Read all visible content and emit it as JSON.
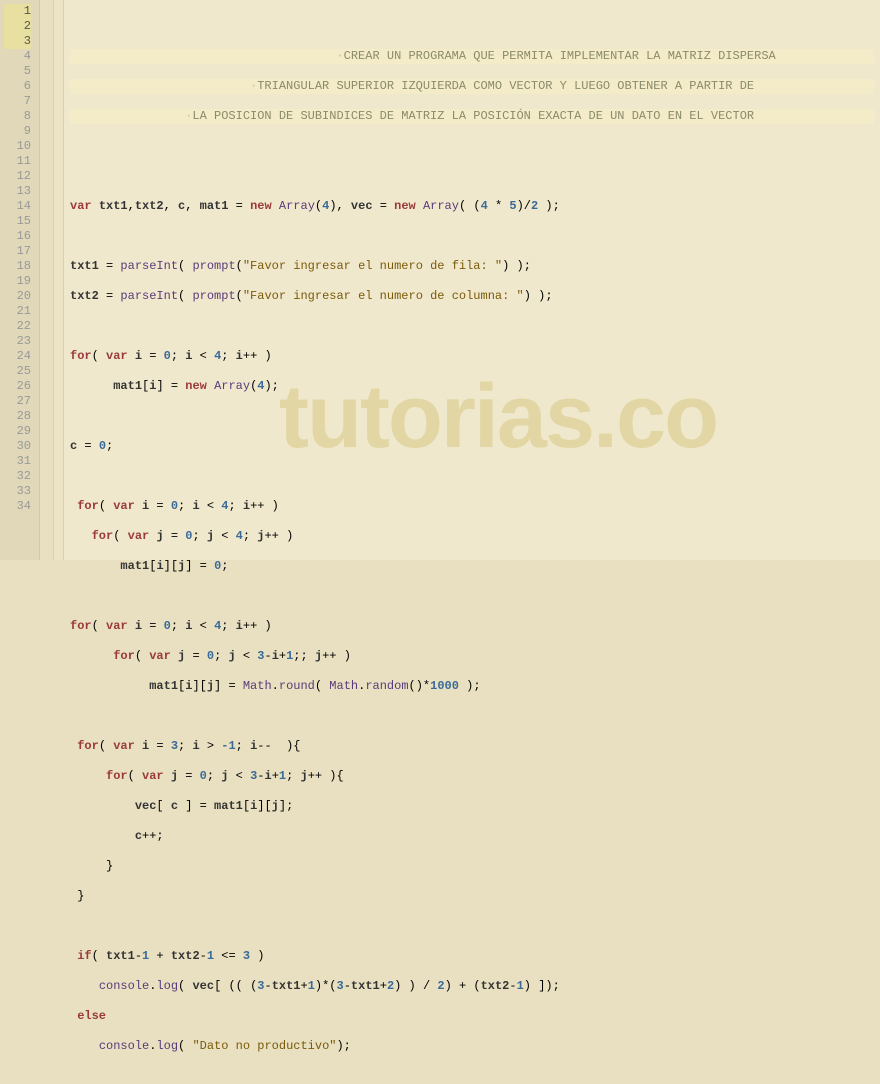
{
  "watermark": "tutorias.co",
  "gutter": {
    "start": 1,
    "end": 34,
    "highlighted": [
      1,
      2,
      3
    ]
  },
  "comments": {
    "l1": "CREAR UN PROGRAMA QUE PERMITA IMPLEMENTAR LA MATRIZ DISPERSA",
    "l2": "TRIANGULAR SUPERIOR IZQUIERDA COMO VECTOR Y LUEGO OBTENER A PARTIR DE",
    "l3": "LA POSICION DE SUBINDICES DE MATRIZ LA POSICIÓN EXACTA DE UN DATO EN EL VECTOR"
  },
  "tokens": {
    "var": "var",
    "new": "new",
    "for": "for",
    "if": "if",
    "else": "else",
    "array": "Array",
    "math": "Math",
    "round": "round",
    "random": "random",
    "parseInt": "parseInt",
    "prompt": "prompt",
    "console": "console",
    "log": "log"
  },
  "ids": {
    "txt1": "txt1",
    "txt2": "txt2",
    "c": "c",
    "mat1": "mat1",
    "vec": "vec",
    "i": "i",
    "j": "j"
  },
  "nums": {
    "n4": "4",
    "n5": "5",
    "n2": "2",
    "n0": "0",
    "n1": "1",
    "n3": "3",
    "nm1": "-1",
    "n1000": "1000"
  },
  "strings": {
    "promptRow": "\"Favor ingresar el numero de fila: \"",
    "promptCol": "\"Favor ingresar el numero de columna: \"",
    "noData": "\"Dato no productivo\""
  }
}
